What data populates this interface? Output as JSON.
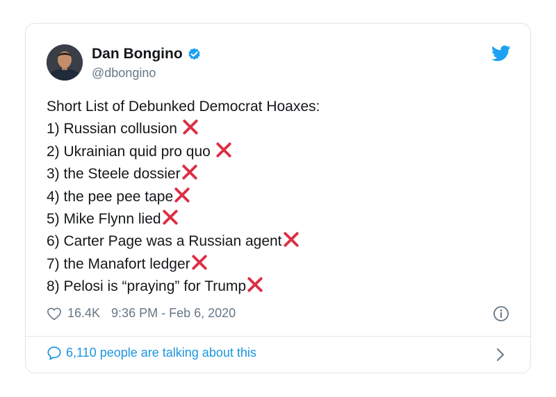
{
  "author": {
    "name": "Dan Bongino",
    "handle": "@dbongino"
  },
  "tweet": {
    "lines": [
      "Short List of Debunked Democrat Hoaxes:",
      "1) Russian collusion",
      "2) Ukrainian quid pro quo",
      "3) the Steele dossier",
      "4) the pee pee tape",
      "5) Mike Flynn lied",
      "6) Carter Page was a Russian agent",
      "7) the Manafort ledger",
      "8) Pelosi is “praying” for Trump"
    ]
  },
  "meta": {
    "likes": "16.4K",
    "timestamp": "9:36 PM - Feb 6, 2020"
  },
  "footer": {
    "talking_text": "6,110 people are talking about this"
  },
  "icons": {
    "verified": "verified-badge-icon",
    "brand": "twitter-bird-icon",
    "cross": "cross-mark-icon",
    "like": "heart-icon",
    "info": "info-icon",
    "reply": "speech-bubble-icon",
    "next": "chevron-right-icon"
  },
  "colors": {
    "brand_blue": "#1da1f2",
    "link_blue": "#1b95e0",
    "cross_red": "#dd2e44",
    "muted_gray": "#657786"
  }
}
